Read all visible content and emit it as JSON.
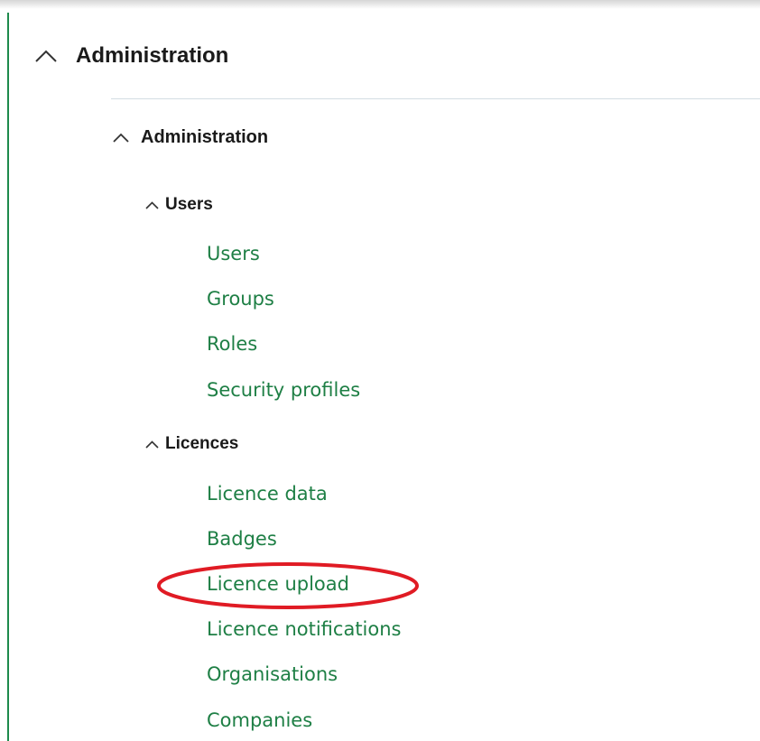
{
  "admin_panel": {
    "title": "Administration",
    "subsection": {
      "title": "Administration",
      "groups": [
        {
          "title": "Users",
          "items": [
            {
              "label": "Users"
            },
            {
              "label": "Groups"
            },
            {
              "label": "Roles"
            },
            {
              "label": "Security profiles"
            }
          ]
        },
        {
          "title": "Licences",
          "items": [
            {
              "label": "Licence data"
            },
            {
              "label": "Badges"
            },
            {
              "label": "Licence upload"
            },
            {
              "label": "Licence notifications"
            },
            {
              "label": "Organisations"
            },
            {
              "label": "Companies"
            }
          ]
        }
      ]
    }
  },
  "highlight": {
    "target": "Licence upload",
    "color": "#e01b24"
  },
  "colors": {
    "link": "#1e7f45",
    "accent_bar": "#1e8a4c",
    "heading": "#1a1a1a",
    "divider": "#d3dde3"
  },
  "icons": {
    "collapse": "chevron-up-icon"
  }
}
